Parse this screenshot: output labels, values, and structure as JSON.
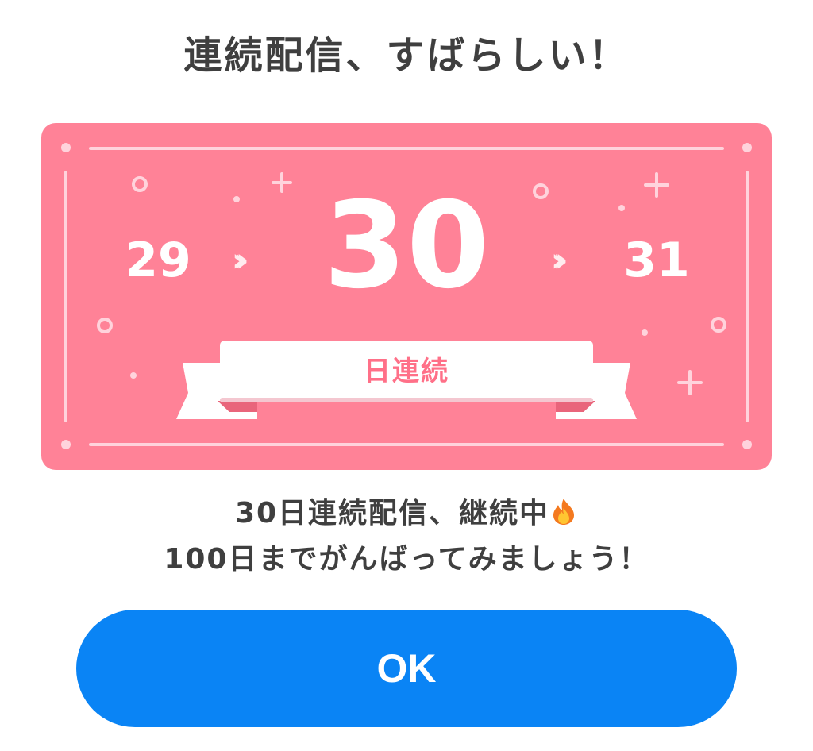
{
  "dialog": {
    "title": "連続配信、すばらしい！",
    "card": {
      "background_color": "#ff8297",
      "previous_day": "29",
      "current_day": "30",
      "next_day": "31",
      "arrow_icon": "double-chevron-right-icon",
      "ribbon_label": "日連続"
    },
    "message_line1": "30日連続配信、継続中",
    "message_icon": "fire-icon",
    "message_line2": "100日までがんばってみましょう！",
    "ok_button_label": "OK",
    "accent_color": "#0a84f5"
  }
}
